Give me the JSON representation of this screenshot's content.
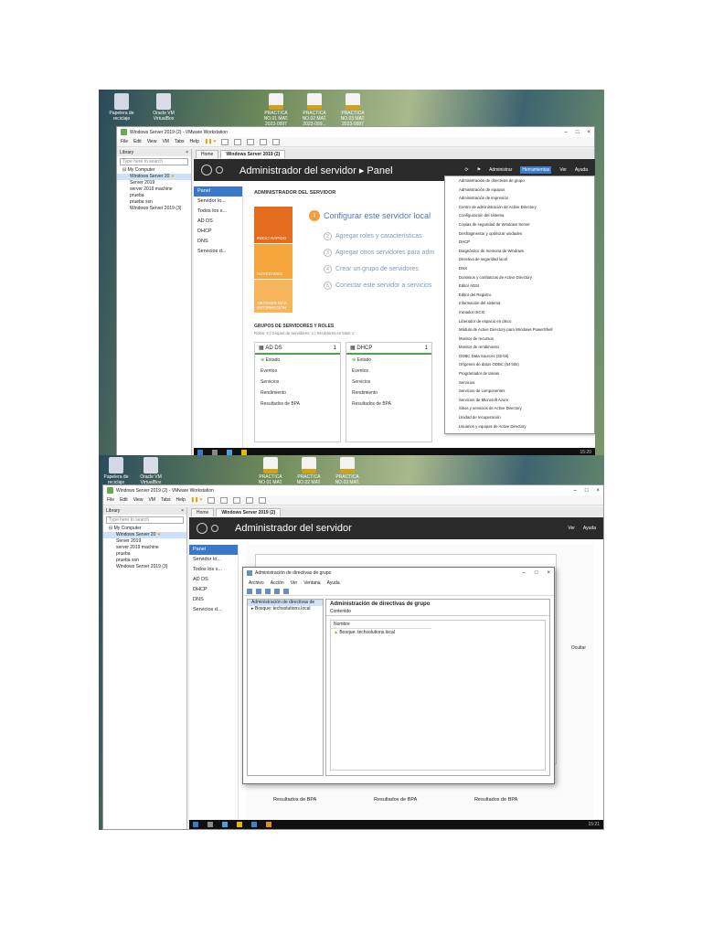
{
  "desktop": {
    "icons": [
      {
        "label": "Papelera de reciclaje",
        "icon": "recycle-bin-icon"
      },
      {
        "label": "Oracle VM VirtualBox",
        "icon": "virtualbox-icon"
      },
      {
        "label": "PRACTICA NO.01 MAT. 2023-0997",
        "icon": "pdf-file-icon"
      },
      {
        "label": "PRACTICA NO.02 MAT. 2023-099...",
        "icon": "pdf-file-icon"
      },
      {
        "label": "PRACTICA NO.03 MAT. 2023-0997",
        "icon": "pdf-file-icon"
      }
    ]
  },
  "vmware": {
    "title": "Windows Server 2019 (2) - VMware Workstation",
    "menu": [
      "File",
      "Edit",
      "View",
      "VM",
      "Tabs",
      "Help"
    ],
    "library": {
      "title": "Library",
      "close": "×",
      "search_placeholder": "Type here to search",
      "tree": {
        "root": "My Computer",
        "items": [
          "Windows Server 20",
          "Server 2019",
          "server 2019 machine",
          "prueba",
          "prueba ssn",
          "Windows Server 2019 (3)"
        ]
      }
    },
    "tabs": [
      "Home",
      "Windows Server 2019 (2)"
    ]
  },
  "server_manager": {
    "breadcrumb": "Administrador del servidor",
    "section": "Panel",
    "menus": [
      "Administrar",
      "Herramientas",
      "Ver",
      "Ayuda"
    ],
    "sidebar": [
      "Panel",
      "Servidor lo...",
      "Todos los s...",
      "AD DS",
      "DHCP",
      "DNS",
      "Servicios d..."
    ],
    "welcome_title": "ADMINISTRADOR DEL SERVIDOR",
    "quick_start": {
      "labels": [
        "INICIO RÁPIDO",
        "NOVEDADES",
        "OBTENER MÁS INFORMACIÓN"
      ],
      "steps": [
        {
          "n": "1",
          "text": "Configurar este servidor local"
        },
        {
          "n": "2",
          "text": "Agregar roles y características"
        },
        {
          "n": "3",
          "text": "Agregar otros servidores para adm"
        },
        {
          "n": "4",
          "text": "Crear un grupo de servidores"
        },
        {
          "n": "5",
          "text": "Conectar este servidor a servicios"
        }
      ]
    },
    "groups_title": "GRUPOS DE SERVIDORES Y ROLES",
    "groups_sub": "Roles: 4 | Grupos de servidores: 1 | Servidores en total: 1",
    "cards": [
      {
        "name": "AD DS",
        "count": "1",
        "rows": [
          "Estado",
          "Eventos",
          "Servicios",
          "Rendimiento",
          "Resultados de BPA"
        ]
      },
      {
        "name": "DHCP",
        "count": "1",
        "rows": [
          "Estado",
          "Eventos",
          "Servicios",
          "Rendimiento",
          "Resultados de BPA"
        ]
      }
    ],
    "hide_label": "Ocultar",
    "bpa_labels": [
      "Resultados de BPA",
      "Resultados de BPA",
      "Resultados de BPA"
    ]
  },
  "tools_menu": [
    "Administración de directivas de grupo",
    "Administración de equipos",
    "Administración de impresión",
    "Centro de administración de Active Directory",
    "Configuración del sistema",
    "Copias de seguridad de Windows Server",
    "Desfragmentar y optimizar unidades",
    "DHCP",
    "Diagnóstico de memoria de Windows",
    "Directiva de seguridad local",
    "DNS",
    "Dominios y confianzas de Active Directory",
    "Editor ADSI",
    "Editor del Registro",
    "Información del sistema",
    "Iniciador iSCSI",
    "Liberador de espacio en disco",
    "Módulo de Active Directory para Windows PowerShell",
    "Monitor de recursos",
    "Monitor de rendimiento",
    "ODBC Data Sources (32-bit)",
    "Orígenes de datos ODBC (64 bits)",
    "Programador de tareas",
    "Servicios",
    "Servicios de componentes",
    "Servicios de Microsoft Azure",
    "Sitios y servicios de Active Directory",
    "Unidad de recuperación",
    "Usuarios y equipos de Active Directory"
  ],
  "taskbar": {
    "clock1": "15:20",
    "clock2": "15:21"
  },
  "gpo_dialog": {
    "title": "Administración de directivas de grupo",
    "menu": [
      "Archivo",
      "Acción",
      "Ver",
      "Ventana",
      "Ayuda"
    ],
    "tree": [
      "Administración de directivas de",
      "Bosque: techsolutions.local"
    ],
    "header": "Administración de directivas de grupo",
    "tab": "Contenido",
    "column": "Nombre",
    "item": "Bosque: techsolutions.local"
  }
}
